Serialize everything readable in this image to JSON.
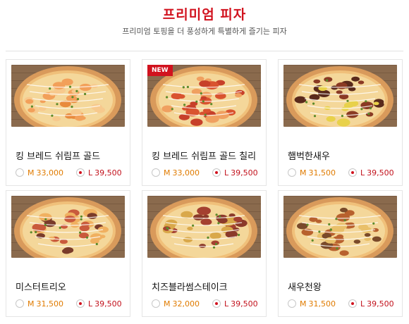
{
  "header": {
    "title": "프리미엄 피자",
    "subtitle": "프리미엄 토핑을 더 풍성하게 특별하게 즐기는 피자"
  },
  "colors": {
    "accent": "#d1121e",
    "price_orange": "#e07b00"
  },
  "cards": [
    {
      "name": "킹 브레드 쉬림프 골드",
      "badge": "",
      "image": "shrimp-pizza-image",
      "options": [
        {
          "size": "M",
          "price": "33,000",
          "selected": false
        },
        {
          "size": "L",
          "price": "39,500",
          "selected": true
        }
      ]
    },
    {
      "name": "킹 브레드 쉬림프 골드 칠리",
      "badge": "NEW",
      "image": "chili-shrimp-pizza-image",
      "options": [
        {
          "size": "M",
          "price": "33,000",
          "selected": false
        },
        {
          "size": "L",
          "price": "39,500",
          "selected": true
        }
      ]
    },
    {
      "name": "햄벅한새우",
      "badge": "",
      "image": "meat-shrimp-pizza-image",
      "options": [
        {
          "size": "M",
          "price": "31,500",
          "selected": false
        },
        {
          "size": "L",
          "price": "39,500",
          "selected": true
        }
      ]
    },
    {
      "name": "미스터트리오",
      "badge": "",
      "image": "trio-pizza-image",
      "options": [
        {
          "size": "M",
          "price": "31,500",
          "selected": false
        },
        {
          "size": "L",
          "price": "39,500",
          "selected": true
        }
      ]
    },
    {
      "name": "치즈블라썸스테이크",
      "badge": "",
      "image": "steak-pizza-image",
      "options": [
        {
          "size": "M",
          "price": "32,000",
          "selected": false
        },
        {
          "size": "L",
          "price": "39,500",
          "selected": true
        }
      ]
    },
    {
      "name": "새우천왕",
      "badge": "",
      "image": "shrimp-king-pizza-image",
      "options": [
        {
          "size": "M",
          "price": "31,500",
          "selected": false
        },
        {
          "size": "L",
          "price": "39,500",
          "selected": true
        }
      ]
    }
  ]
}
